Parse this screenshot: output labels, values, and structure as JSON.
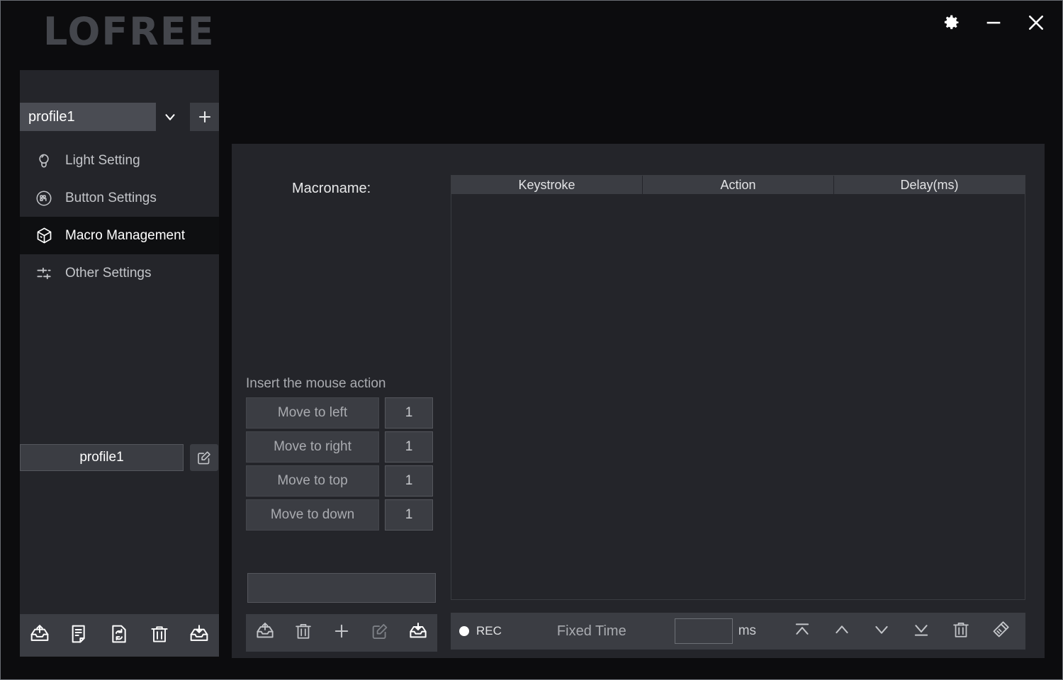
{
  "app": {
    "logo_text": "LOFREE",
    "accent_bg": "#24252a",
    "panel_bg": "#0e0f11",
    "control_bg": "#3b3d43",
    "text_color": "#ffffff",
    "muted_text": "#a9abb0"
  },
  "titlebar": {
    "settings_icon": "gear-icon",
    "minimize_icon": "minimize-icon",
    "close_icon": "close-icon"
  },
  "sidebar": {
    "profile_select": {
      "value": "profile1",
      "caret_icon": "chevron-down-icon",
      "add_icon": "plus-icon"
    },
    "nav_items": [
      {
        "label": "Light Setting",
        "icon": "lightbulb-icon",
        "active": false
      },
      {
        "label": "Button Settings",
        "icon": "keypad-icon",
        "active": false
      },
      {
        "label": "Macro Management",
        "icon": "cube-icon",
        "active": true
      },
      {
        "label": "Other Settings",
        "icon": "sliders-icon",
        "active": false
      }
    ],
    "profile_item": {
      "label": "profile1",
      "edit_icon": "edit-square-icon"
    },
    "toolbar": [
      {
        "name": "export-profile-button",
        "icon": "tray-up-icon"
      },
      {
        "name": "new-profile-button",
        "icon": "document-icon"
      },
      {
        "name": "reset-profile-button",
        "icon": "file-refresh-icon"
      },
      {
        "name": "delete-profile-button",
        "icon": "trash-icon"
      },
      {
        "name": "import-profile-button",
        "icon": "tray-down-icon"
      }
    ]
  },
  "main": {
    "macroname_label": "Macroname:",
    "macroname_value": "",
    "mouse_section": {
      "title": "Insert the mouse action",
      "rows": [
        {
          "label": "Move to left",
          "value": "1"
        },
        {
          "label": "Move to right",
          "value": "1"
        },
        {
          "label": "Move to top",
          "value": "1"
        },
        {
          "label": "Move to down",
          "value": "1"
        }
      ]
    },
    "macro_toolbar": [
      {
        "name": "export-macro-button",
        "icon": "tray-up-icon"
      },
      {
        "name": "delete-macro-button",
        "icon": "trash-icon"
      },
      {
        "name": "add-macro-button",
        "icon": "plus-icon"
      },
      {
        "name": "edit-macro-button",
        "icon": "edit-square-icon"
      },
      {
        "name": "import-macro-button",
        "icon": "tray-down-icon"
      }
    ],
    "table": {
      "columns": [
        "Keystroke",
        "Action",
        "Delay(ms)"
      ],
      "rows": []
    },
    "recbar": {
      "rec_label": "REC",
      "fixed_time_label": "Fixed Time",
      "delay_value": "",
      "ms_label": "ms",
      "actions": [
        {
          "name": "move-to-top-button",
          "icon": "move-to-top-icon"
        },
        {
          "name": "move-up-button",
          "icon": "chevron-up-icon"
        },
        {
          "name": "move-down-button",
          "icon": "chevron-down-icon"
        },
        {
          "name": "move-to-bottom-button",
          "icon": "move-to-bottom-icon"
        },
        {
          "name": "delete-step-button",
          "icon": "trash-icon"
        },
        {
          "name": "clear-all-button",
          "icon": "brush-icon"
        }
      ]
    }
  }
}
